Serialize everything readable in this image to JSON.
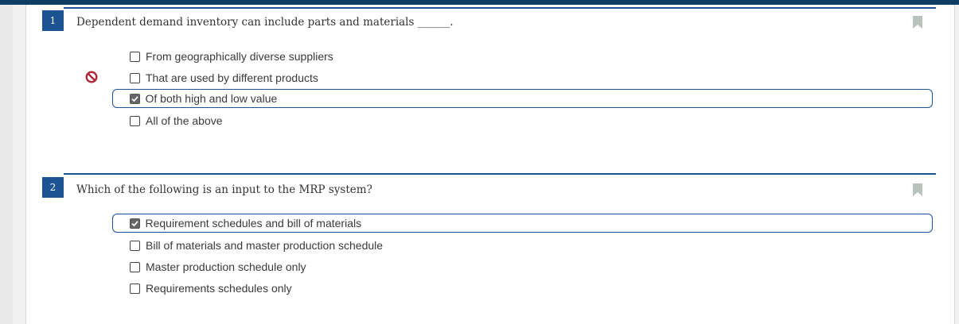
{
  "questions": [
    {
      "number": "1",
      "text": "Dependent demand inventory can include parts and materials ______.",
      "result_icon": "incorrect-circle-slash-icon",
      "choices": [
        {
          "label": "From geographically diverse suppliers",
          "checked": false
        },
        {
          "label": "That are used by different products",
          "checked": false
        },
        {
          "label": "Of both high and low value",
          "checked": true
        },
        {
          "label": "All of the above",
          "checked": false
        }
      ]
    },
    {
      "number": "2",
      "text": "Which of the following is an input to the MRP system?",
      "choices": [
        {
          "label": "Requirement schedules and bill of materials",
          "checked": true
        },
        {
          "label": "Bill of materials and master production schedule",
          "checked": false
        },
        {
          "label": "Master production schedule only",
          "checked": false
        },
        {
          "label": "Requirements schedules only",
          "checked": false
        }
      ]
    }
  ],
  "colors": {
    "header_bar": "#0e3e68",
    "accent": "#1b5393",
    "incorrect": "#b0263a",
    "bookmark": "#b9c2bd"
  },
  "icons": {
    "bookmark": "bookmark-icon",
    "incorrect": "circle-slash-icon",
    "checkmark": "checkmark-icon"
  }
}
